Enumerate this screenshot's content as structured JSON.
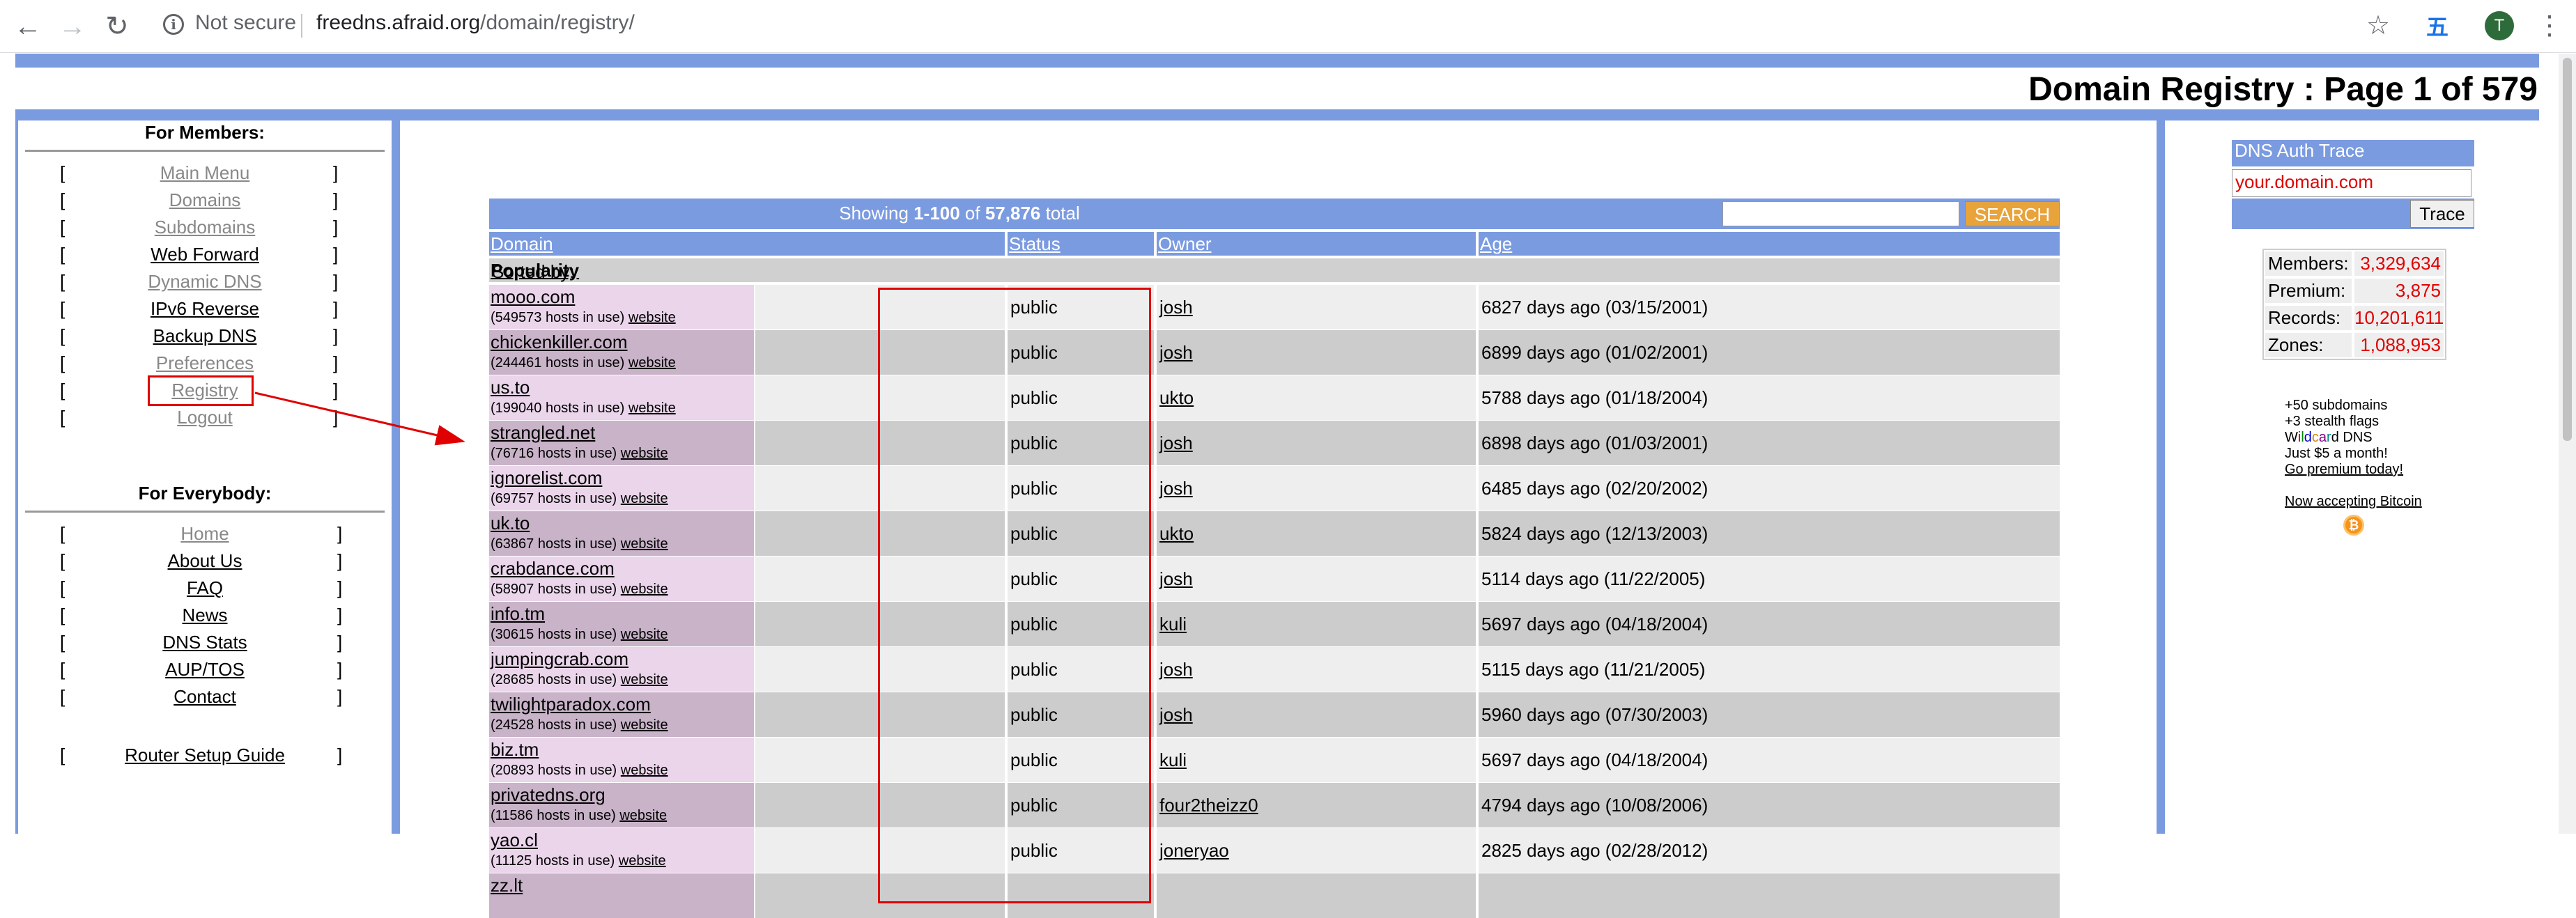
{
  "browser": {
    "security": "Not secure",
    "url_host": "freedns.afraid.org",
    "url_path": "/domain/registry/",
    "avatar_letter": "T",
    "translate_glyph": "五"
  },
  "page": {
    "title": "Domain Registry : Page 1 of 579"
  },
  "left": {
    "members_heading": "For Members:",
    "members_items": [
      {
        "label": "Main Menu",
        "style": "gray"
      },
      {
        "label": "Domains",
        "style": "gray"
      },
      {
        "label": "Subdomains",
        "style": "gray"
      },
      {
        "label": "Web Forward",
        "style": "black"
      },
      {
        "label": "Dynamic DNS",
        "style": "gray"
      },
      {
        "label": "IPv6 Reverse",
        "style": "black"
      },
      {
        "label": "Backup DNS",
        "style": "black"
      },
      {
        "label": "Preferences",
        "style": "gray"
      },
      {
        "label": "Registry",
        "style": "gray"
      },
      {
        "label": "Logout",
        "style": "gray"
      }
    ],
    "everybody_heading": "For Everybody:",
    "everybody_items": [
      {
        "label": "Home",
        "style": "gray"
      },
      {
        "label": "About Us",
        "style": "black"
      },
      {
        "label": "FAQ",
        "style": "black"
      },
      {
        "label": "News",
        "style": "black"
      },
      {
        "label": "DNS Stats",
        "style": "black"
      },
      {
        "label": "AUP/TOS",
        "style": "black"
      },
      {
        "label": "Contact",
        "style": "black"
      }
    ],
    "router_guide": "Router Setup Guide",
    "bracket_open": "[",
    "bracket_close": "]"
  },
  "table": {
    "showing_prefix": "Showing ",
    "showing_range": "1-100",
    "showing_of": " of ",
    "showing_total": "57,876",
    "showing_suffix": " total",
    "search_label": "SEARCH",
    "columns": [
      "Domain",
      "Status",
      "Owner",
      "Age"
    ],
    "sorted_prefix": "Sorted by: ",
    "sorted_by": "Popularity",
    "website_label": "website",
    "rows": [
      {
        "domain": "mooo.com",
        "hosts": "(549573 hosts in use)",
        "status": "public",
        "owner": "josh",
        "age": "6827 days ago (03/15/2001)"
      },
      {
        "domain": "chickenkiller.com",
        "hosts": "(244461 hosts in use)",
        "status": "public",
        "owner": "josh",
        "age": "6899 days ago (01/02/2001)"
      },
      {
        "domain": "us.to",
        "hosts": "(199040 hosts in use)",
        "status": "public",
        "owner": "ukto",
        "age": "5788 days ago (01/18/2004)"
      },
      {
        "domain": "strangled.net",
        "hosts": "(76716 hosts in use)",
        "status": "public",
        "owner": "josh",
        "age": "6898 days ago (01/03/2001)"
      },
      {
        "domain": "ignorelist.com",
        "hosts": "(69757 hosts in use)",
        "status": "public",
        "owner": "josh",
        "age": "6485 days ago (02/20/2002)"
      },
      {
        "domain": "uk.to",
        "hosts": "(63867 hosts in use)",
        "status": "public",
        "owner": "ukto",
        "age": "5824 days ago (12/13/2003)"
      },
      {
        "domain": "crabdance.com",
        "hosts": "(58907 hosts in use)",
        "status": "public",
        "owner": "josh",
        "age": "5114 days ago (11/22/2005)"
      },
      {
        "domain": "info.tm",
        "hosts": "(30615 hosts in use)",
        "status": "public",
        "owner": "kuli",
        "age": "5697 days ago (04/18/2004)"
      },
      {
        "domain": "jumpingcrab.com",
        "hosts": "(28685 hosts in use)",
        "status": "public",
        "owner": "josh",
        "age": "5115 days ago (11/21/2005)"
      },
      {
        "domain": "twilightparadox.com",
        "hosts": "(24528 hosts in use)",
        "status": "public",
        "owner": "josh",
        "age": "5960 days ago (07/30/2003)"
      },
      {
        "domain": "biz.tm",
        "hosts": "(20893 hosts in use)",
        "status": "public",
        "owner": "kuli",
        "age": "5697 days ago (04/18/2004)"
      },
      {
        "domain": "privatedns.org",
        "hosts": "(11586 hosts in use)",
        "status": "public",
        "owner": "four2theizz0",
        "age": "4794 days ago (10/08/2006)"
      },
      {
        "domain": "yao.cl",
        "hosts": "(11125 hosts in use)",
        "status": "public",
        "owner": "joneryao",
        "age": "2825 days ago (02/28/2012)"
      },
      {
        "domain": "zz.lt",
        "hosts": "",
        "status": "",
        "owner": "",
        "age": ""
      }
    ]
  },
  "right": {
    "auth_title": "DNS Auth Trace",
    "auth_input": "your.domain.com",
    "trace_label": "Trace",
    "stats": [
      {
        "k": "Members:",
        "v": "3,329,634"
      },
      {
        "k": "Premium:",
        "v": "3,875"
      },
      {
        "k": "Records:",
        "v": "10,201,611"
      },
      {
        "k": "Zones:",
        "v": "1,088,953"
      }
    ],
    "promo_lines": [
      "+50 subdomains",
      "+3 stealth flags"
    ],
    "wildcard": "Wildcard",
    "wildcard_suffix": " DNS",
    "price": "Just $5 a month!",
    "premium_link": "Go premium today!",
    "bitcoin_link": "Now accepting Bitcoin",
    "bitcoin_glyph": "₿"
  },
  "colors": {
    "accent_blue": "#7b9be0",
    "search_orange": "#e8a33a",
    "highlight_red": "#e00000",
    "row_light": "#eeeeee",
    "row_dark": "#cccccc",
    "domain_col_light": "#ead5ea",
    "domain_col_dark": "#c8b3c8"
  }
}
